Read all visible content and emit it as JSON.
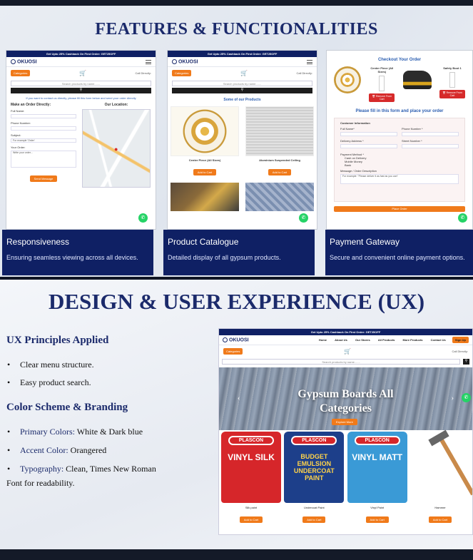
{
  "slide1": {
    "title": "FEATURES & FUNCTIONALITIES",
    "cards": [
      {
        "caption_title": "Responsiveness",
        "caption_desc": "Ensuring seamless viewing across all devices.",
        "promo": "Get Upto 25% Cashback On First Order: GET25OFF",
        "brand": "OKUOSI",
        "category_chip": "Categories",
        "call": "Call Directly:",
        "search_placeholder": "Search products by name.......",
        "contact_note": "If you want to contact us directly, please fill this form below and send your order directly",
        "order_heading": "Make an Order Directly:",
        "location_heading": "Our Location:",
        "fields": [
          "Full Name:",
          "Phone Number:",
          "Subject:",
          "Your Order:"
        ],
        "subject_placeholder": "For example 'Order'",
        "order_placeholder": "Write your order...",
        "send_button": "Send Message"
      },
      {
        "caption_title": "Product Catalogue",
        "caption_desc": "Detailed display of all gypsum products.",
        "promo": "Get Upto 25% Cashback On First Order: GET25OFF",
        "brand": "OKUOSI",
        "category_chip": "Categories",
        "call": "Call Directly:",
        "search_placeholder": "Search products by name.......",
        "section_heading": "Some of our Products",
        "products": [
          {
            "name": "Center Piece (All Sizes)",
            "button": "Add to Cart"
          },
          {
            "name": "Aluminium Suspended Ceiling",
            "button": "Add to Cart"
          }
        ]
      },
      {
        "caption_title": "Payment Gateway",
        "caption_desc": "Secure and convenient online payment options.",
        "checkout_title": "Checkout Your Order",
        "items": [
          {
            "name": "Center Piece (All Sizes)",
            "remove": "Remove From Cart"
          },
          {
            "name": "Safety Boot 1",
            "remove": "Remove From Cart"
          }
        ],
        "form_title": "Please fill in this form and place your order",
        "info_heading": "Customer Information",
        "fields": [
          "Full Name*",
          "Phone Number *",
          "Delivery Address *",
          "Street Number *"
        ],
        "payment_heading": "Payment Method *",
        "payment_options": [
          "Cash on Delivery",
          "Mobile Money",
          "Bank"
        ],
        "message_label": "Message / Order Description",
        "message_placeholder": "For example: \"Please deliver it as fast as you can\"",
        "place_order": "Place Order"
      }
    ]
  },
  "slide2": {
    "title": "DESIGN & USER EXPERIENCE (UX)",
    "ux_heading": "UX Principles Applied",
    "ux_points": [
      "Clear menu structure.",
      "Easy product search."
    ],
    "color_heading": "Color Scheme & Branding",
    "primary_label": "Primary Colors:",
    "primary_value": " White & Dark blue",
    "accent_label": "Accent Color:",
    "accent_value": " Orangered",
    "typo_label": "Typography:",
    "typo_value": " Clean, Times New Roman",
    "typo_cont": "Font for readability.",
    "desktop": {
      "promo": "Get Upto 25% Cashback On First Order: GET25OFF",
      "brand": "OKUOSI",
      "nav": [
        "Home",
        "About Us",
        "Our Stores",
        "All Products",
        "More Products",
        "Contact Us"
      ],
      "nav_button": "Sign Up",
      "category_chip": "Categories",
      "call": "Call Directly:",
      "search_placeholder": "Search products by name.......",
      "hero_line1": "Gypsum Boards All",
      "hero_line2": "Categories",
      "hero_button": "Explore More",
      "products": [
        {
          "name": "Silk paint",
          "button": "Add to Cart",
          "brand": "PLASCON",
          "label": "VINYL SILK",
          "color": "#d6262a"
        },
        {
          "name": "Undercoat Paint",
          "button": "Add to Cart",
          "brand": "PLASCON",
          "label": "BUDGET EMULSION UNDERCOAT PAINT",
          "color": "#1d3f8a"
        },
        {
          "name": "Vinyl Paint",
          "button": "Add to Cart",
          "brand": "PLASCON",
          "label": "VINYL MATT",
          "color": "#3a9ad6"
        },
        {
          "name": "Hammer",
          "button": "Add to Cart"
        }
      ]
    }
  },
  "colors": {
    "navy": "#1b2a6b",
    "caption_bg": "#0f2064",
    "accent": "#f07a1a",
    "whatsapp": "#25d366"
  }
}
